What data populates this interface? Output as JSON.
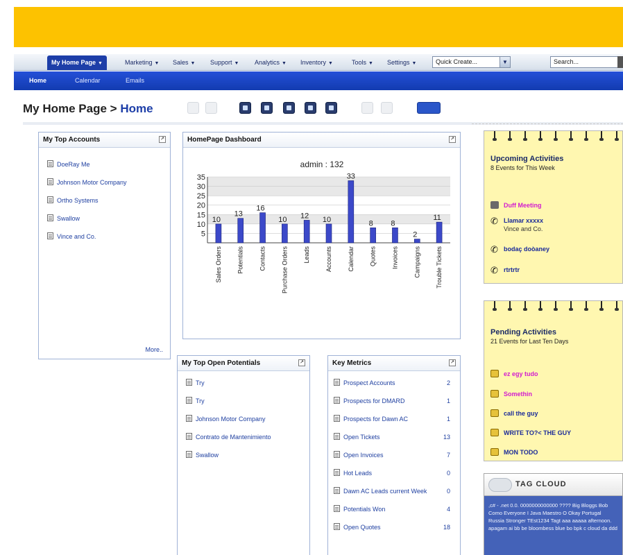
{
  "colors": {
    "banner": "#fdc200",
    "nav_active": "#1d3ea8",
    "subnav": "#2450d8",
    "link": "#1e3fa0",
    "notepad": "#fff7b0",
    "bar": "#3c49c9"
  },
  "menu": {
    "items": [
      "My Home Page",
      "Marketing",
      "Sales",
      "Support",
      "Analytics",
      "Inventory",
      "Tools",
      "Settings"
    ],
    "quick_create": "Quick Create...",
    "search_placeholder": "Search..."
  },
  "subnav": {
    "items": [
      "Home",
      "Calendar",
      "Emails"
    ]
  },
  "page": {
    "title_prefix": "My Home Page > ",
    "title_current": "Home"
  },
  "top_accounts": {
    "title": "My Top Accounts",
    "items": [
      "DoeRay Me",
      "Johnson Motor Company",
      "Ortho Systems",
      "Swallow",
      "Vince and Co."
    ],
    "more": "More.."
  },
  "dashboard": {
    "title": "HomePage Dashboard"
  },
  "chart_data": {
    "type": "bar",
    "title": "admin : 132",
    "categories": [
      "Sales Orders",
      "Potentials",
      "Contacts",
      "Purchase Orders",
      "Leads",
      "Accounts",
      "Calendar",
      "Quotes",
      "Invoices",
      "Campaigns",
      "Trouble Tickets"
    ],
    "values": [
      10,
      13,
      16,
      10,
      12,
      10,
      33,
      8,
      8,
      2,
      11
    ],
    "value_labels": [
      "10",
      "13",
      "16",
      "10",
      "12",
      "10",
      "33",
      "8",
      "8",
      "2",
      "11"
    ],
    "ylim": [
      0,
      35
    ],
    "yticks": [
      "5",
      "10",
      "15",
      "20",
      "25",
      "30",
      "35"
    ],
    "grid": true
  },
  "open_potentials": {
    "title": "My Top Open Potentials",
    "items": [
      "Try",
      "Try",
      "Johnson Motor Company",
      "Contrato de Mantenimiento",
      "Swallow"
    ]
  },
  "key_metrics": {
    "title": "Key Metrics",
    "items": [
      {
        "label": "Prospect Accounts",
        "value": "2"
      },
      {
        "label": "Prospects for DMARD",
        "value": "1"
      },
      {
        "label": "Prospects for Dawn AC",
        "value": "1"
      },
      {
        "label": "Open Tickets",
        "value": "13"
      },
      {
        "label": "Open Invoices",
        "value": "7"
      },
      {
        "label": "Hot Leads",
        "value": "0"
      },
      {
        "label": "Dawn AC Leads current Week",
        "value": "0"
      },
      {
        "label": "Potentials Won",
        "value": "4"
      },
      {
        "label": "Open Quotes",
        "value": "18"
      }
    ]
  },
  "upcoming": {
    "title": "Upcoming Activities",
    "subtitle": "8 Events for This Week",
    "items": [
      {
        "label": "Duff Meeting",
        "sub": ""
      },
      {
        "label": "Llamar xxxxx",
        "sub": "Vince and Co."
      },
      {
        "label": "bodaç doòaney",
        "sub": ""
      },
      {
        "label": "rtrtrtr",
        "sub": ""
      }
    ]
  },
  "pending": {
    "title": "Pending Activities",
    "subtitle": "21 Events for Last Ten Days",
    "items": [
      "ez egy tudo",
      "Somethin",
      "call the guy",
      "WRITE TO?< THE GUY",
      "MON TODO"
    ]
  },
  "tagcloud": {
    "title": "TAG CLOUD",
    "text": ",c# - .net 0.0. 0000000000000 ???? Big Bloggs Bob Como Everyone I Java Maestro O Okay Portugal Russia Stronger TEst1234 Tagt aaa aaaaa afternoon. apagam ai bb be bloombess blue bo bpk c cloud da ddd"
  }
}
